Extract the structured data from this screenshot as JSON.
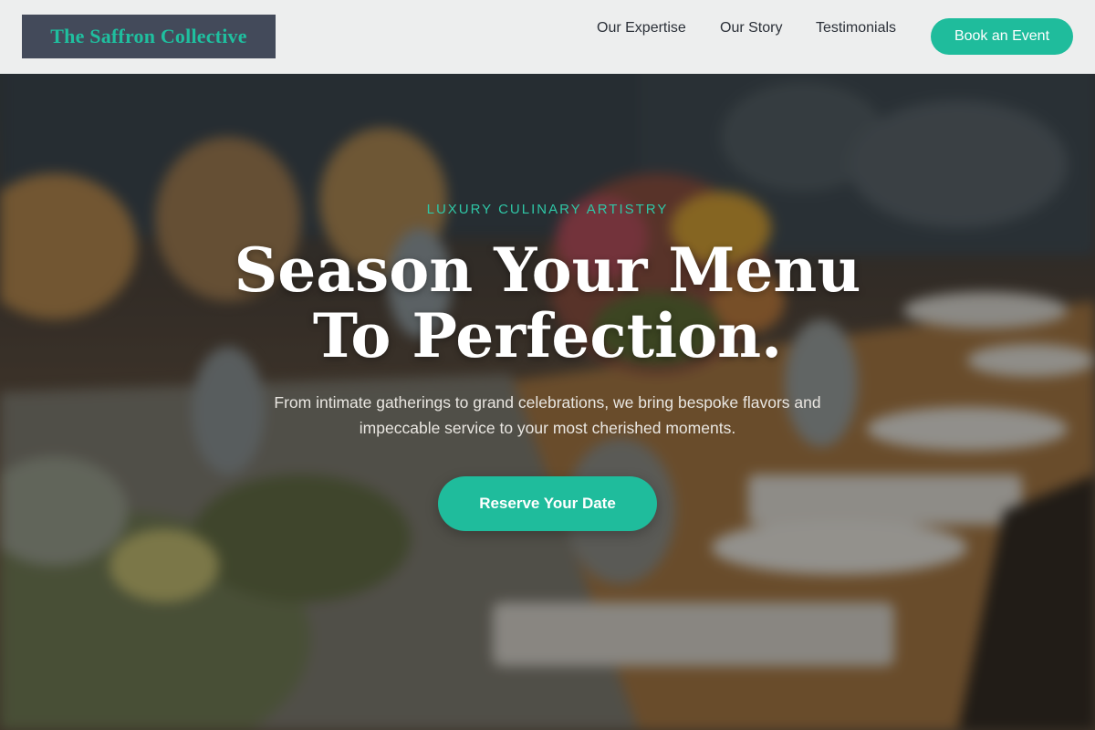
{
  "brand": {
    "name": "The Saffron Collective",
    "accent_color": "#1fbc9c",
    "logo_bg_color": "#434a5a"
  },
  "nav": {
    "items": [
      {
        "label": "Our Expertise"
      },
      {
        "label": "Our Story"
      },
      {
        "label": "Testimonials"
      }
    ],
    "cta_label": "Book an Event"
  },
  "hero": {
    "eyebrow": "LUXURY CULINARY ARTISTRY",
    "headline_line1": "Season Your Menu",
    "headline_line2": "To Perfection.",
    "subtext": "From intimate gatherings to grand celebrations, we bring bespoke flavors and impeccable service to your most cherished moments.",
    "cta_label": "Reserve Your Date"
  }
}
